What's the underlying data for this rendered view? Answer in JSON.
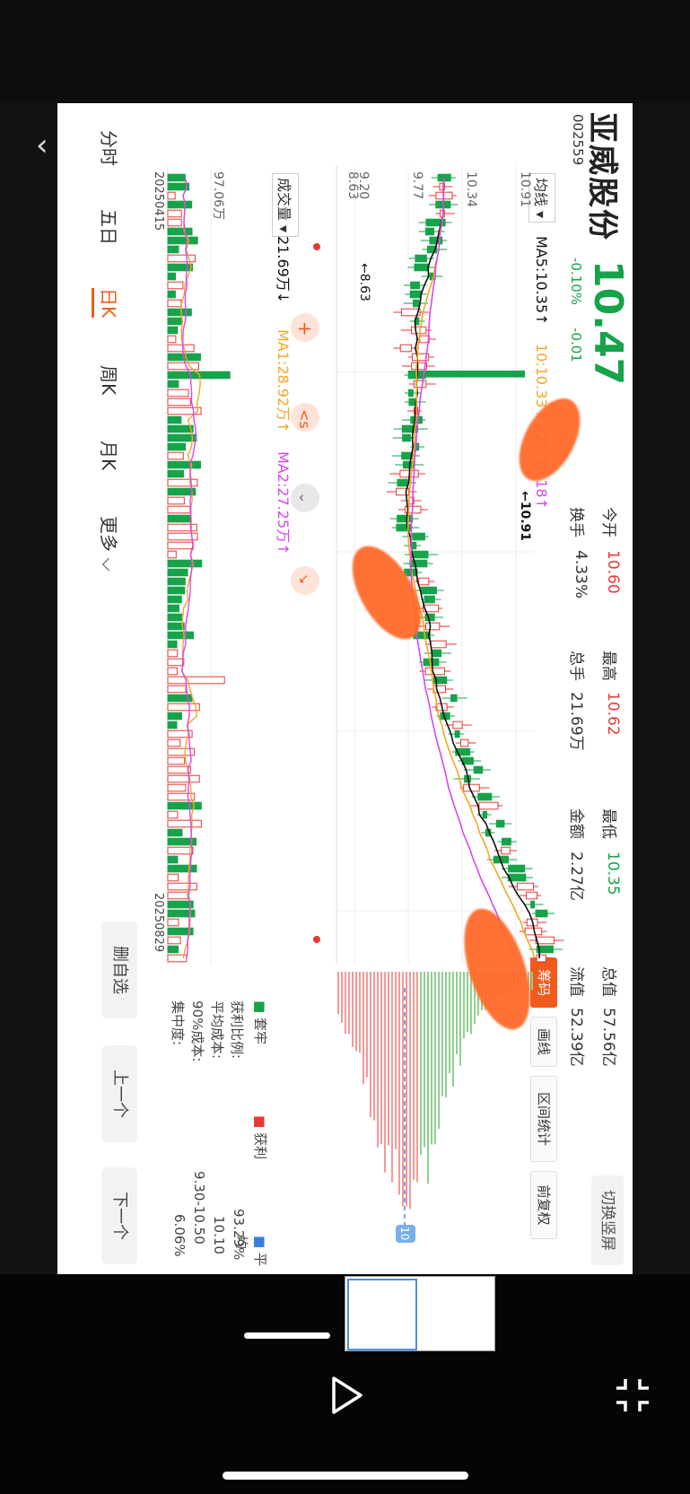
{
  "stock": {
    "name": "亚威股份",
    "code": "002559",
    "price": "10.47",
    "change_pct": "-0.10%",
    "change": "-0.01",
    "open_label": "今开",
    "open": "10.60",
    "high_label": "最高",
    "high": "10.62",
    "low_label": "最低",
    "low": "10.35",
    "turnover_label": "换手",
    "turnover": "4.33%",
    "volume_label": "总手",
    "volume": "21.69万",
    "amount_label": "金额",
    "amount": "2.27亿",
    "mktcap_label": "总值",
    "mktcap": "57.56亿",
    "float_label": "流值",
    "float": "52.39亿"
  },
  "switch_btn": "切换竖屏",
  "ma": {
    "label": "均线",
    "ma5": "MA5:10.35↑",
    "ma10": "10:10.33↑",
    "ma20": "20:10.18↑"
  },
  "tools": {
    "chip": "筹码",
    "draw": "画线",
    "stats": "区间统计",
    "adjust": "前复权"
  },
  "price_axis": {
    "t1": "10.91",
    "t2": "10.34",
    "t3": "9.77",
    "t4": "9.20",
    "t5": "8.63"
  },
  "annotations": {
    "high_mark": "←10.91",
    "low_mark": "←8.63"
  },
  "volume_panel": {
    "label": "成交量",
    "vol": "21.69万↓",
    "ma1": "MA1:28.92万↑",
    "ma2": "MA2:27.25万↑",
    "max": "97.06万"
  },
  "dates": {
    "start": "20250415",
    "end": "20250829"
  },
  "chip_legend": {
    "trapped": "套牢",
    "profit": "获利",
    "avg": "平均",
    "profit_ratio_label": "获利比例:",
    "profit_ratio": "93.29%",
    "avg_cost_label": "平均成本:",
    "avg_cost": "10.10",
    "cost90_label": "90%成本:",
    "cost90": "9.30-10.50",
    "concentration_label": "集中度:",
    "concentration": "6.06%",
    "tag": "10"
  },
  "period_tabs": [
    "分时",
    "五日",
    "日K",
    "周K",
    "月K",
    "更多"
  ],
  "active_period": "日K",
  "actions": {
    "delete": "删自选",
    "prev": "上一个",
    "next": "下一个"
  },
  "colors": {
    "up": "#e53935",
    "down": "#16a34a",
    "ma5": "#111111",
    "ma10": "#f5a623",
    "ma20": "#d946ef",
    "accent": "#f05a1a"
  }
}
